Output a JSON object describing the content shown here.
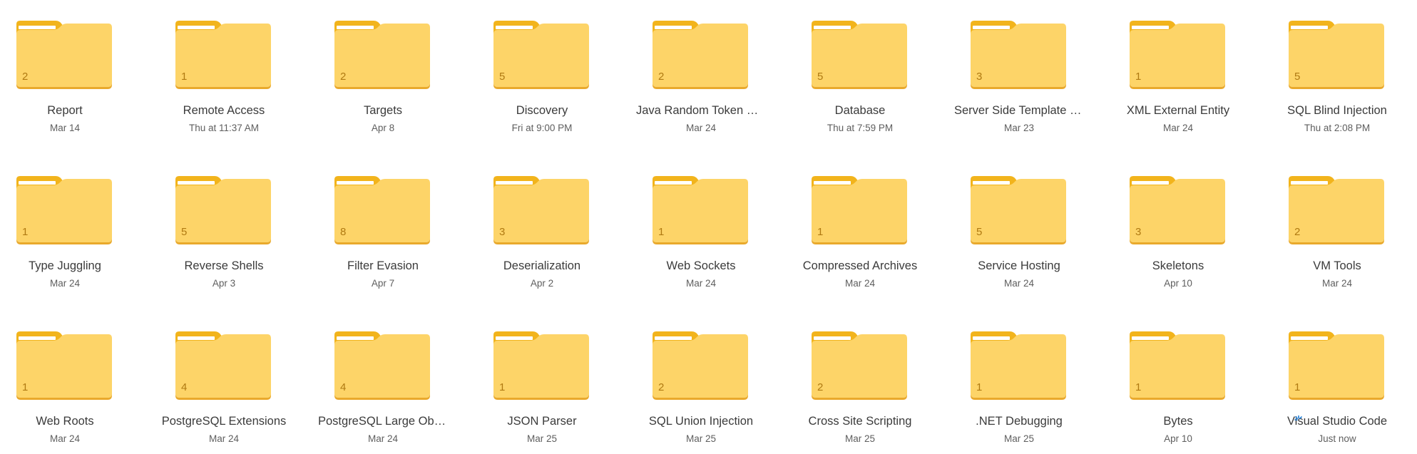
{
  "colors": {
    "folder_back": "#f2b41c",
    "folder_front": "#fdd468",
    "folder_edge": "#e9a92c",
    "count_text": "#b07a12"
  },
  "folders": [
    {
      "name": "Report",
      "date": "Mar 14",
      "count": "2"
    },
    {
      "name": "Remote Access",
      "date": "Thu at 11:37 AM",
      "count": "1"
    },
    {
      "name": "Targets",
      "date": "Apr 8",
      "count": "2"
    },
    {
      "name": "Discovery",
      "date": "Fri at 9:00 PM",
      "count": "5"
    },
    {
      "name": "Java Random Token Ge...",
      "date": "Mar 24",
      "count": "2"
    },
    {
      "name": "Database",
      "date": "Thu at 7:59 PM",
      "count": "5"
    },
    {
      "name": "Server Side Template Inj...",
      "date": "Mar 23",
      "count": "3"
    },
    {
      "name": "XML External Entity",
      "date": "Mar 24",
      "count": "1"
    },
    {
      "name": "SQL Blind Injection",
      "date": "Thu at 2:08 PM",
      "count": "5"
    },
    {
      "name": "Type Juggling",
      "date": "Mar 24",
      "count": "1"
    },
    {
      "name": "Reverse Shells",
      "date": "Apr 3",
      "count": "5"
    },
    {
      "name": "Filter Evasion",
      "date": "Apr 7",
      "count": "8"
    },
    {
      "name": "Deserialization",
      "date": "Apr 2",
      "count": "3"
    },
    {
      "name": "Web Sockets",
      "date": "Mar 24",
      "count": "1"
    },
    {
      "name": "Compressed Archives",
      "date": "Mar 24",
      "count": "1"
    },
    {
      "name": "Service Hosting",
      "date": "Mar 24",
      "count": "5"
    },
    {
      "name": "Skeletons",
      "date": "Apr 10",
      "count": "3"
    },
    {
      "name": "VM Tools",
      "date": "Mar 24",
      "count": "2"
    },
    {
      "name": "Web Roots",
      "date": "Mar 24",
      "count": "1"
    },
    {
      "name": "PostgreSQL Extensions",
      "date": "Mar 24",
      "count": "4"
    },
    {
      "name": "PostgreSQL Large Objects",
      "date": "Mar 24",
      "count": "4"
    },
    {
      "name": "JSON Parser",
      "date": "Mar 25",
      "count": "1"
    },
    {
      "name": "SQL Union Injection",
      "date": "Mar 25",
      "count": "2"
    },
    {
      "name": "Cross Site Scripting",
      "date": "Mar 25",
      "count": "2"
    },
    {
      "name": ".NET Debugging",
      "date": "Mar 25",
      "count": "1"
    },
    {
      "name": "Bytes",
      "date": "Apr 10",
      "count": "1"
    },
    {
      "name": "Visual Studio Code",
      "date": "Just now",
      "count": "1",
      "syncing": true
    }
  ]
}
